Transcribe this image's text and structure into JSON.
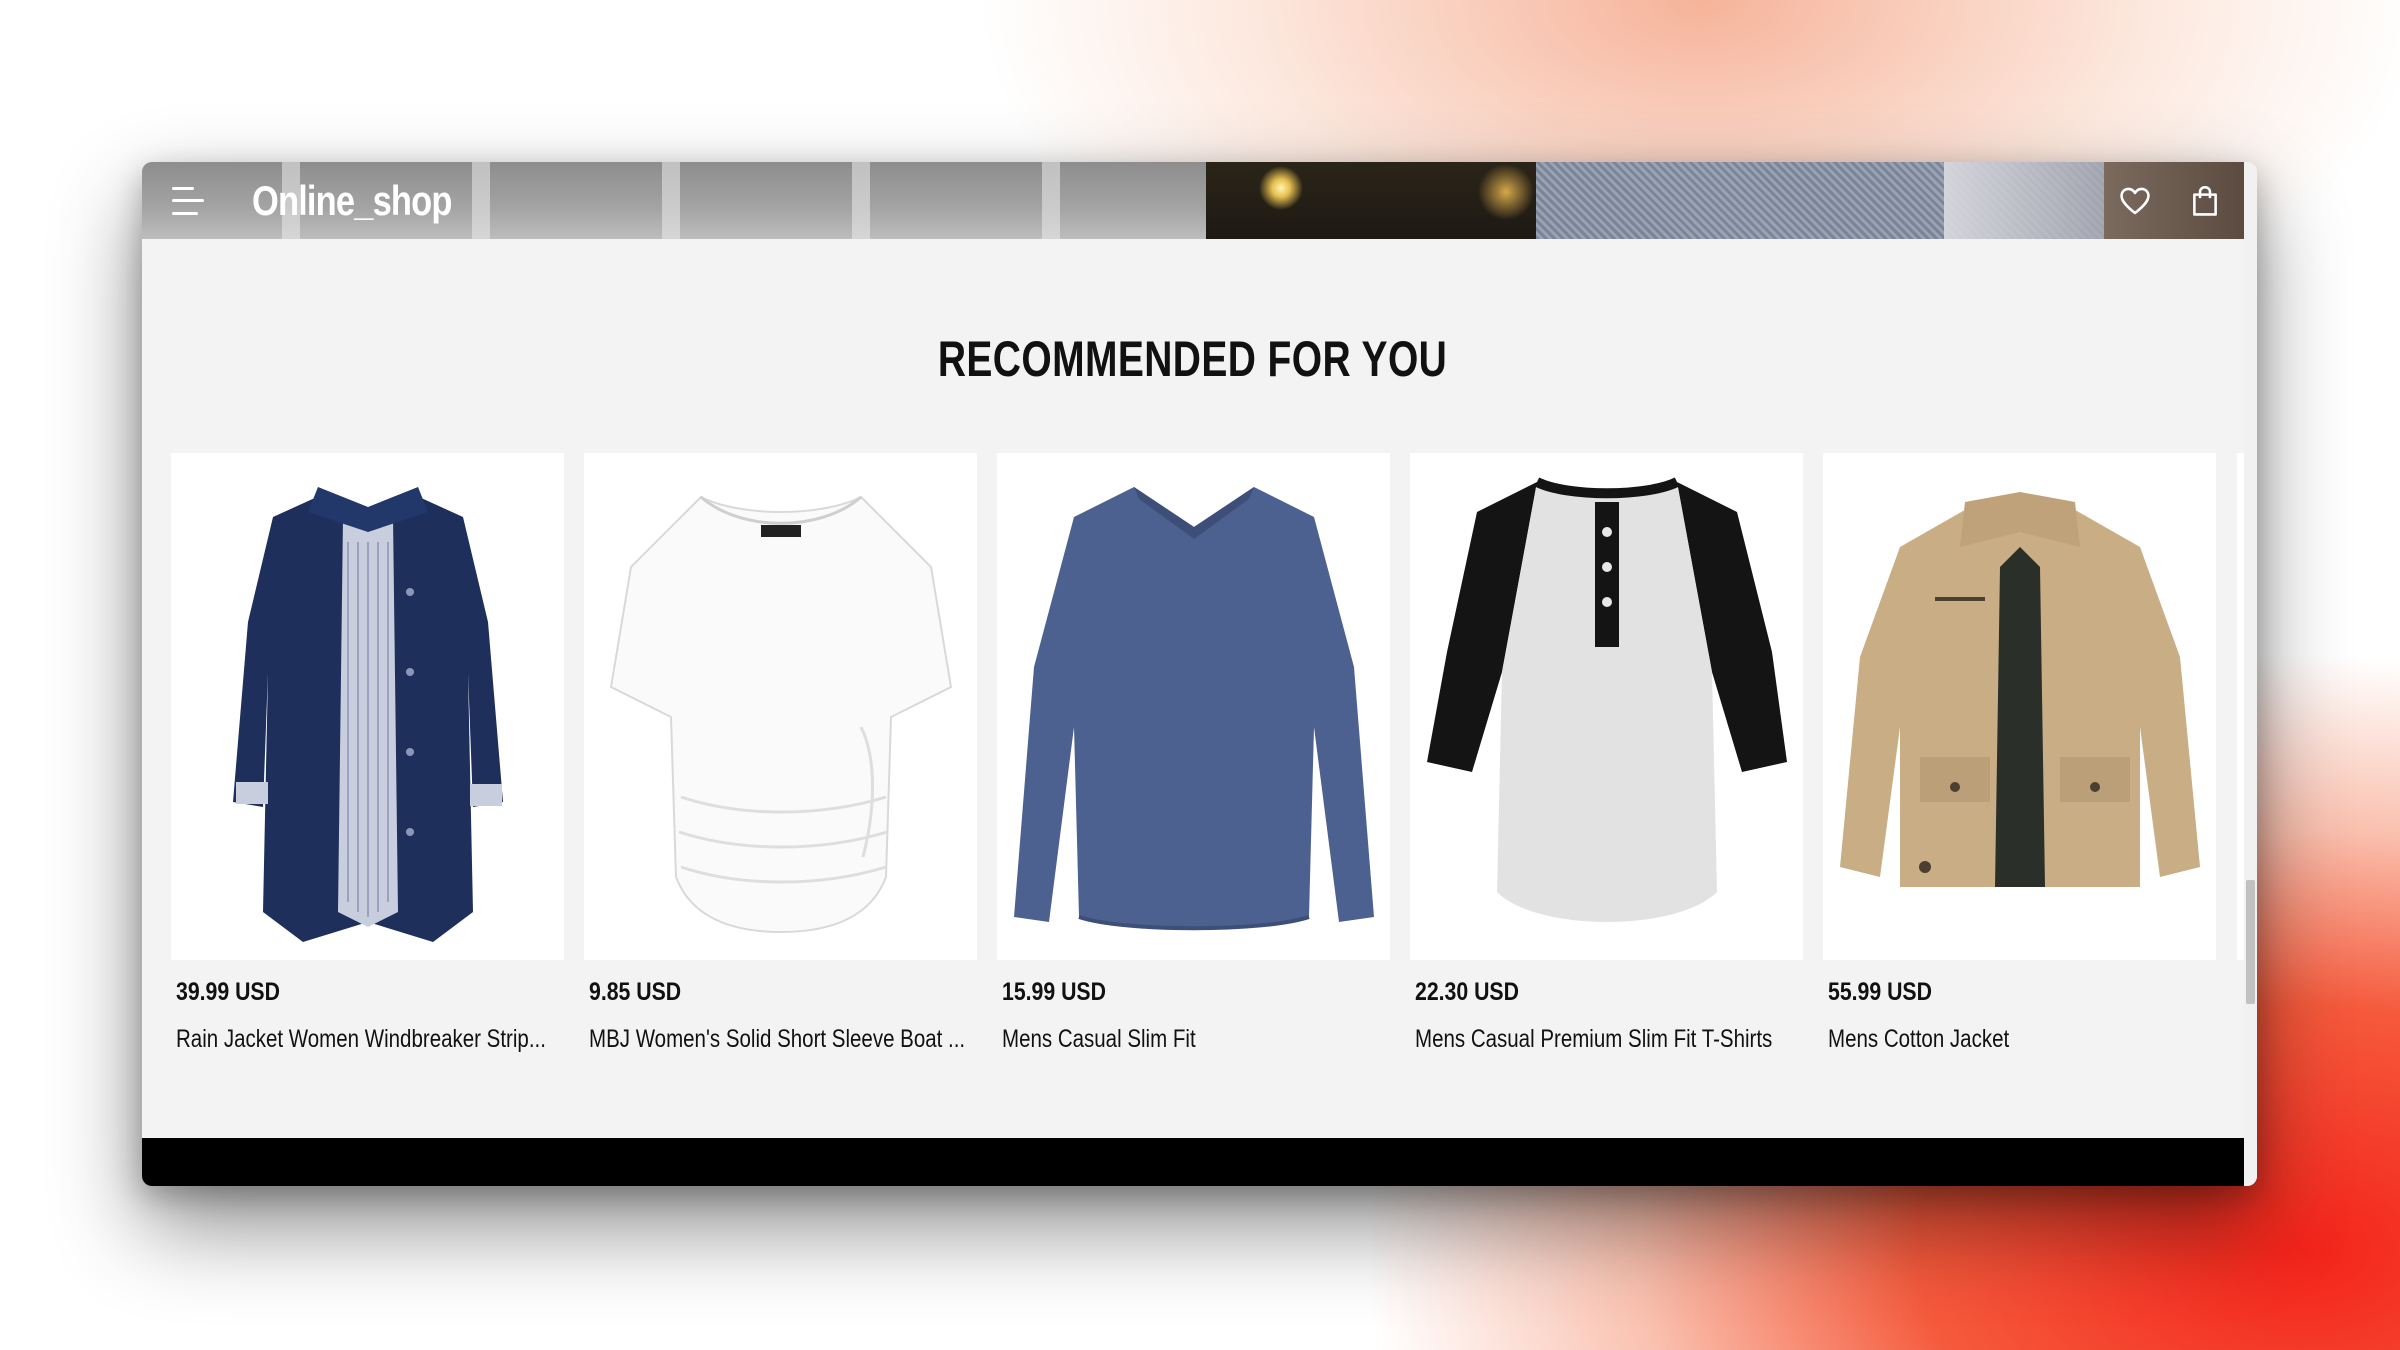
{
  "header": {
    "brand": "Online_shop",
    "menu_icon": "hamburger-menu-icon",
    "wishlist_icon": "heart-icon",
    "cart_icon": "shopping-bag-icon"
  },
  "section": {
    "title": "RECOMMENDED FOR YOU"
  },
  "products": [
    {
      "price": "39.99 USD",
      "name": "Rain Jacket Women Windbreaker Strip...",
      "image": "navy-rain-jacket"
    },
    {
      "price": "9.85 USD",
      "name": "MBJ Women's Solid Short Sleeve Boat ...",
      "image": "white-boat-neck-top"
    },
    {
      "price": "15.99 USD",
      "name": "Mens Casual Slim Fit",
      "image": "blue-long-sleeve-tee"
    },
    {
      "price": "22.30 USD",
      "name": "Mens Casual Premium Slim Fit T-Shirts",
      "image": "raglan-henley-shirt"
    },
    {
      "price": "55.99 USD",
      "name": "Mens Cotton Jacket",
      "image": "khaki-cotton-jacket"
    }
  ],
  "colors": {
    "page_bg": "#f3f3f3",
    "card_bg": "#ffffff",
    "text": "#111111",
    "footer": "#000000"
  }
}
